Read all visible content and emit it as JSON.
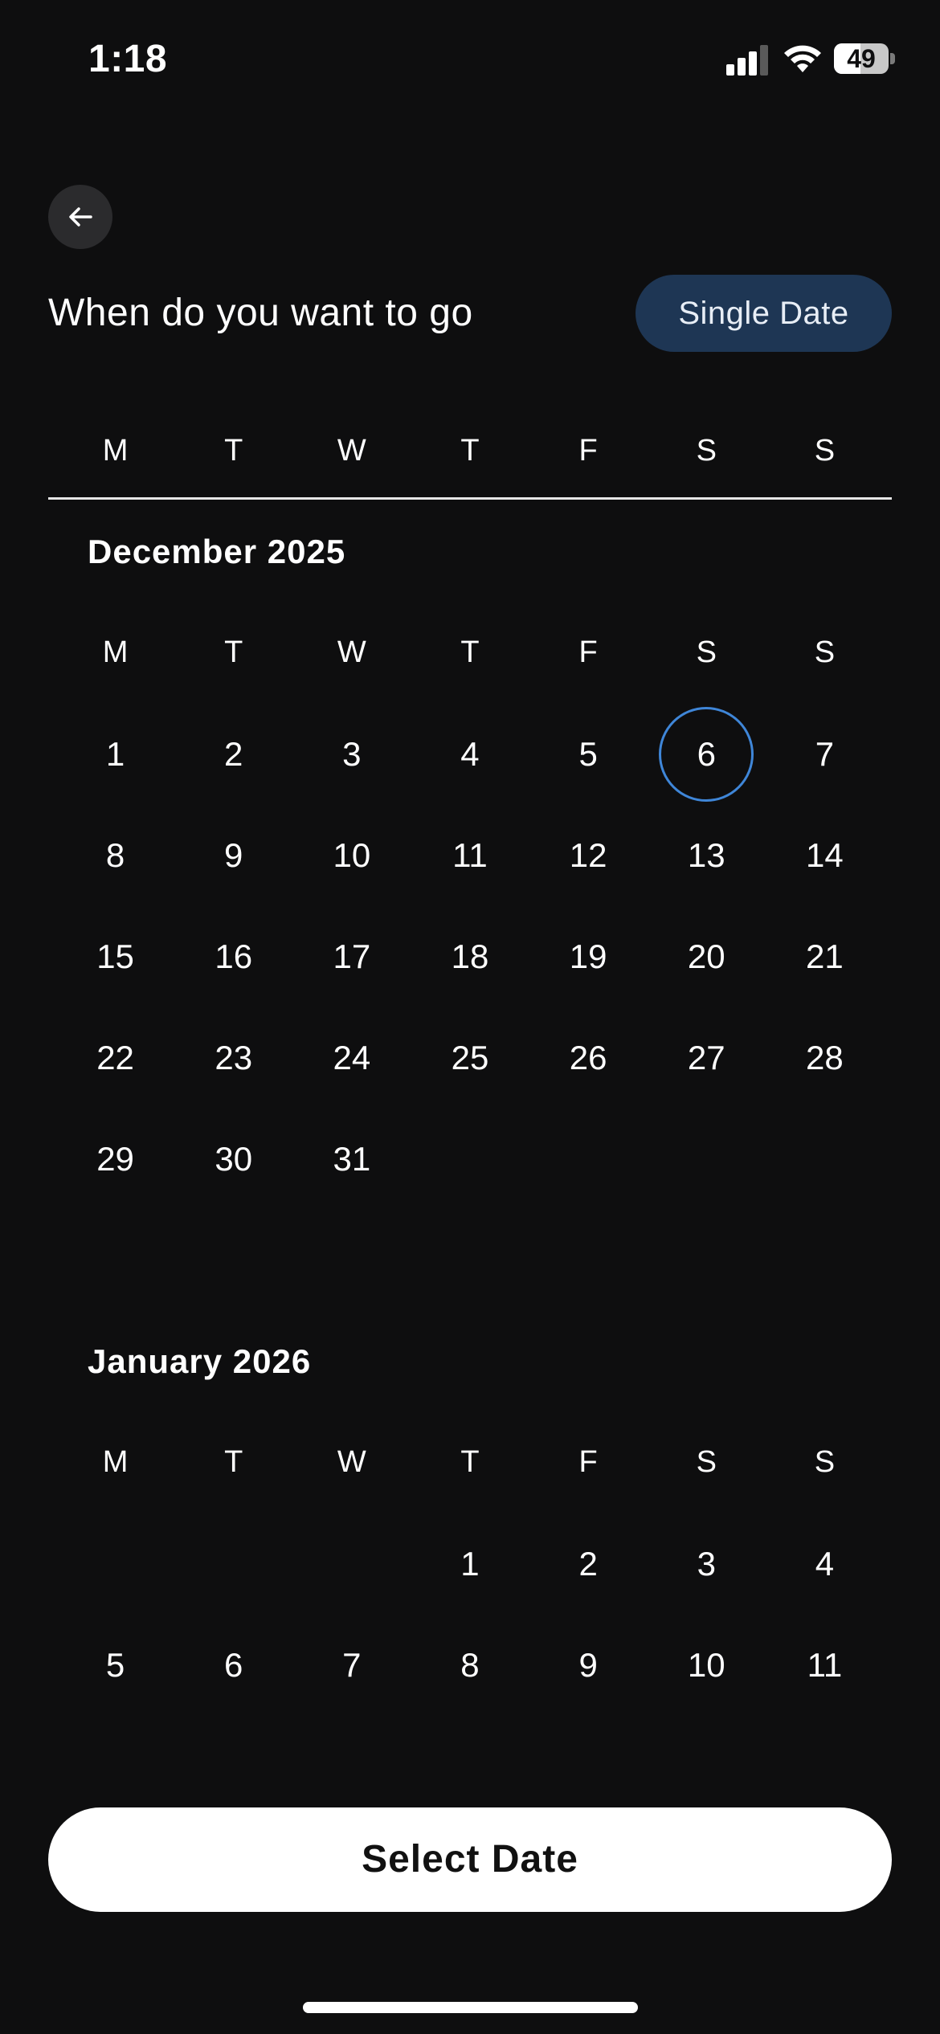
{
  "status_bar": {
    "time": "1:18",
    "battery": "49",
    "battery_level": 0.49,
    "icons": [
      "signal-icon",
      "wifi-icon",
      "battery-icon"
    ]
  },
  "header": {
    "back_icon": "arrow-left-icon",
    "title": "When do you want to go",
    "mode_label": "Single Date"
  },
  "weekdays": [
    "M",
    "T",
    "W",
    "T",
    "F",
    "S",
    "S"
  ],
  "months": [
    {
      "title": "December 2025",
      "leading_blanks": 0,
      "days": 31,
      "selected_day": 6
    },
    {
      "title": "January 2026",
      "leading_blanks": 3,
      "days": 11,
      "selected_day": null
    }
  ],
  "footer": {
    "select_label": "Select Date"
  },
  "colors": {
    "background": "#0e0e0f",
    "accent": "#3f86d8",
    "mode_pill": "#1e3654",
    "primary_button": "#ffffff"
  }
}
